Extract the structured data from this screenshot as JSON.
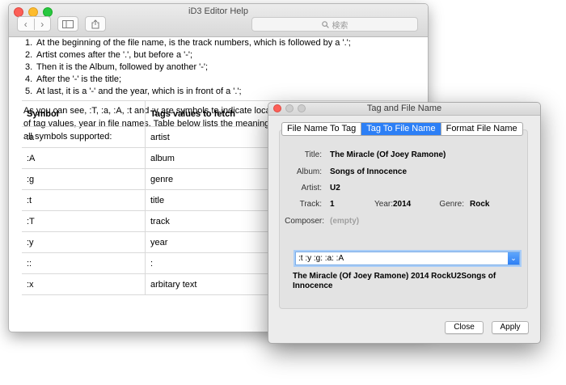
{
  "help_window": {
    "title": "iD3 Editor Help",
    "toolbar": {
      "back_icon": "‹",
      "forward_icon": "›",
      "search_placeholder": "検索"
    },
    "steps": [
      {
        "num": "1.",
        "text": "At the beginning of the file name, is the track numbers, which is followed by a '.';"
      },
      {
        "num": "2.",
        "text": "Artist comes after the '.', but before a '-';"
      },
      {
        "num": "3.",
        "text": "Then it is the Album, followed by another '-';"
      },
      {
        "num": "4.",
        "text": "After the '-' is the title;"
      },
      {
        "num": "5.",
        "text": "At last, it is a '-' and the year, which is in front of a '.';"
      }
    ],
    "paragraph": "As you can see, :T, :a, :A, :t and :y are symbols to indicate locations of tag values, year in file names. Table below lists the meaning of all symbols supported:",
    "table": {
      "headers": [
        "Symbol",
        "Tags values to fetch"
      ],
      "rows": [
        [
          ":a",
          "artist"
        ],
        [
          ":A",
          "album"
        ],
        [
          ":g",
          "genre"
        ],
        [
          ":t",
          "title"
        ],
        [
          ":T",
          "track"
        ],
        [
          ":y",
          "year"
        ],
        [
          "::",
          ":"
        ],
        [
          ":x",
          "arbitary text"
        ]
      ]
    }
  },
  "dialog": {
    "title": "Tag and File Name",
    "tabs": [
      "File Name To Tag",
      "Tag To File Name",
      "Format File Name"
    ],
    "active_tab": "Tag To File Name",
    "fields": {
      "title_label": "Title:",
      "title_value": "The Miracle (Of Joey Ramone)",
      "album_label": "Album:",
      "album_value": "Songs of Innocence",
      "artist_label": "Artist:",
      "artist_value": "U2",
      "track_label": "Track:",
      "track_value": "1",
      "year_label": "Year:",
      "year_value": "2014",
      "genre_label": "Genre:",
      "genre_value": "Rock",
      "composer_label": "Composer:",
      "composer_value": "(empty)"
    },
    "pattern_value": ":t :y :g: :a: :A",
    "preview_text": "The Miracle (Of Joey Ramone) 2014 RockU2Songs of Innocence",
    "buttons": {
      "close": "Close",
      "apply": "Apply"
    }
  }
}
